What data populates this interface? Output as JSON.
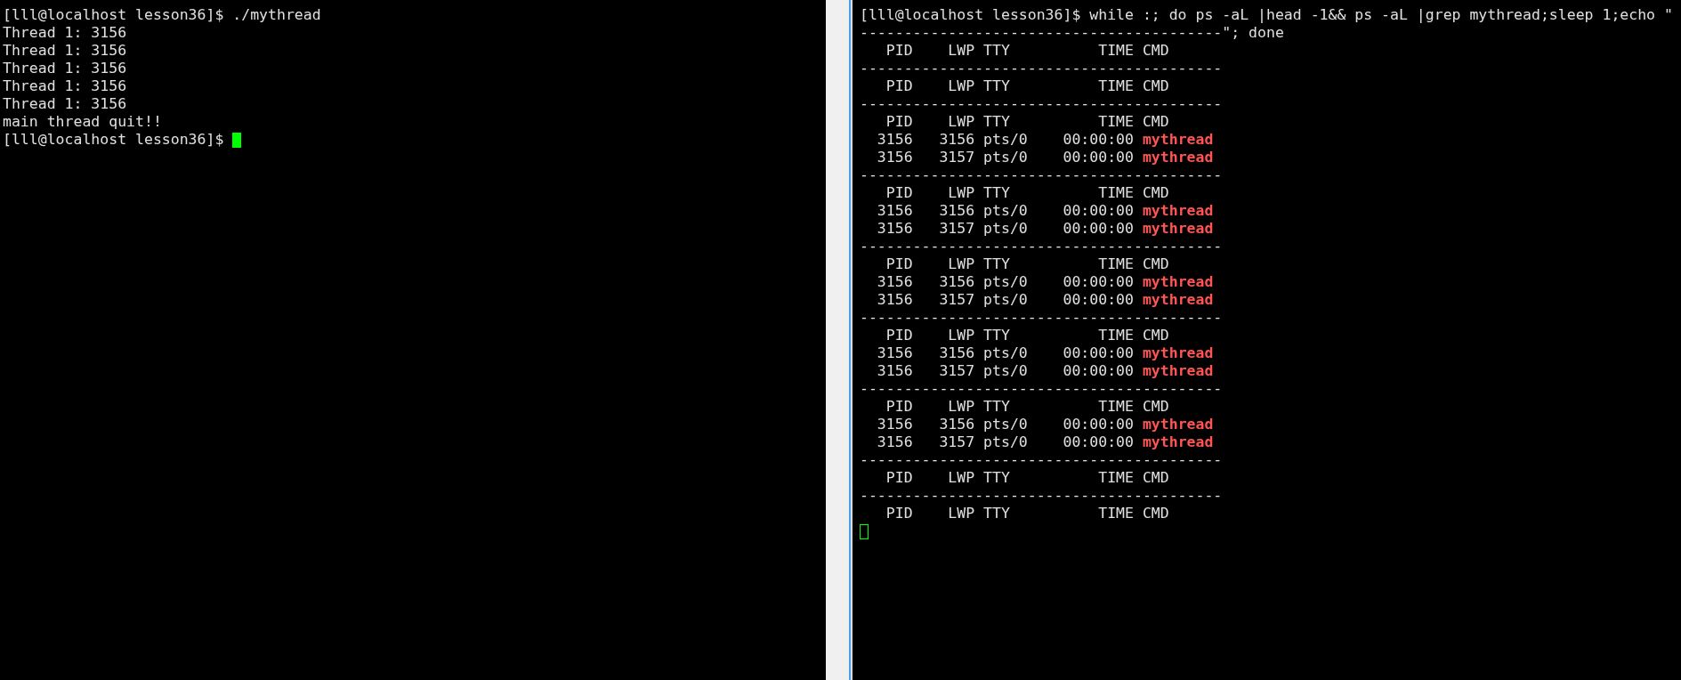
{
  "panes": [
    {
      "focused": true,
      "lines": [
        {
          "kind": "text",
          "text": "[lll@localhost lesson36]$ ./mythread"
        },
        {
          "kind": "text",
          "text": "Thread 1: 3156"
        },
        {
          "kind": "text",
          "text": "Thread 1: 3156"
        },
        {
          "kind": "text",
          "text": "Thread 1: 3156"
        },
        {
          "kind": "text",
          "text": "Thread 1: 3156"
        },
        {
          "kind": "text",
          "text": "Thread 1: 3156"
        },
        {
          "kind": "text",
          "text": "main thread quit!!"
        },
        {
          "kind": "prompt",
          "text": "[lll@localhost lesson36]$ "
        }
      ]
    },
    {
      "focused": false,
      "lines": [
        {
          "kind": "text",
          "text": "[lll@localhost lesson36]$ while :; do ps -aL |head -1&& ps -aL |grep mythread;sleep 1;echo \""
        },
        {
          "kind": "text",
          "text": "-----------------------------------------\"; done"
        },
        {
          "kind": "text",
          "text": "   PID    LWP TTY          TIME CMD"
        },
        {
          "kind": "text",
          "text": "-----------------------------------------"
        },
        {
          "kind": "text",
          "text": "   PID    LWP TTY          TIME CMD"
        },
        {
          "kind": "text",
          "text": "-----------------------------------------"
        },
        {
          "kind": "text",
          "text": "   PID    LWP TTY          TIME CMD"
        },
        {
          "kind": "process",
          "text": "  3156   3156 pts/0    00:00:00 ",
          "cmd": "mythread"
        },
        {
          "kind": "process",
          "text": "  3156   3157 pts/0    00:00:00 ",
          "cmd": "mythread"
        },
        {
          "kind": "text",
          "text": "-----------------------------------------"
        },
        {
          "kind": "text",
          "text": "   PID    LWP TTY          TIME CMD"
        },
        {
          "kind": "process",
          "text": "  3156   3156 pts/0    00:00:00 ",
          "cmd": "mythread"
        },
        {
          "kind": "process",
          "text": "  3156   3157 pts/0    00:00:00 ",
          "cmd": "mythread"
        },
        {
          "kind": "text",
          "text": "-----------------------------------------"
        },
        {
          "kind": "text",
          "text": "   PID    LWP TTY          TIME CMD"
        },
        {
          "kind": "process",
          "text": "  3156   3156 pts/0    00:00:00 ",
          "cmd": "mythread"
        },
        {
          "kind": "process",
          "text": "  3156   3157 pts/0    00:00:00 ",
          "cmd": "mythread"
        },
        {
          "kind": "text",
          "text": "-----------------------------------------"
        },
        {
          "kind": "text",
          "text": "   PID    LWP TTY          TIME CMD"
        },
        {
          "kind": "process",
          "text": "  3156   3156 pts/0    00:00:00 ",
          "cmd": "mythread"
        },
        {
          "kind": "process",
          "text": "  3156   3157 pts/0    00:00:00 ",
          "cmd": "mythread"
        },
        {
          "kind": "text",
          "text": "-----------------------------------------"
        },
        {
          "kind": "text",
          "text": "   PID    LWP TTY          TIME CMD"
        },
        {
          "kind": "process",
          "text": "  3156   3156 pts/0    00:00:00 ",
          "cmd": "mythread"
        },
        {
          "kind": "process",
          "text": "  3156   3157 pts/0    00:00:00 ",
          "cmd": "mythread"
        },
        {
          "kind": "text",
          "text": "-----------------------------------------"
        },
        {
          "kind": "text",
          "text": "   PID    LWP TTY          TIME CMD"
        },
        {
          "kind": "text",
          "text": "-----------------------------------------"
        },
        {
          "kind": "text",
          "text": "   PID    LWP TTY          TIME CMD"
        },
        {
          "kind": "prompt"
        }
      ]
    }
  ]
}
